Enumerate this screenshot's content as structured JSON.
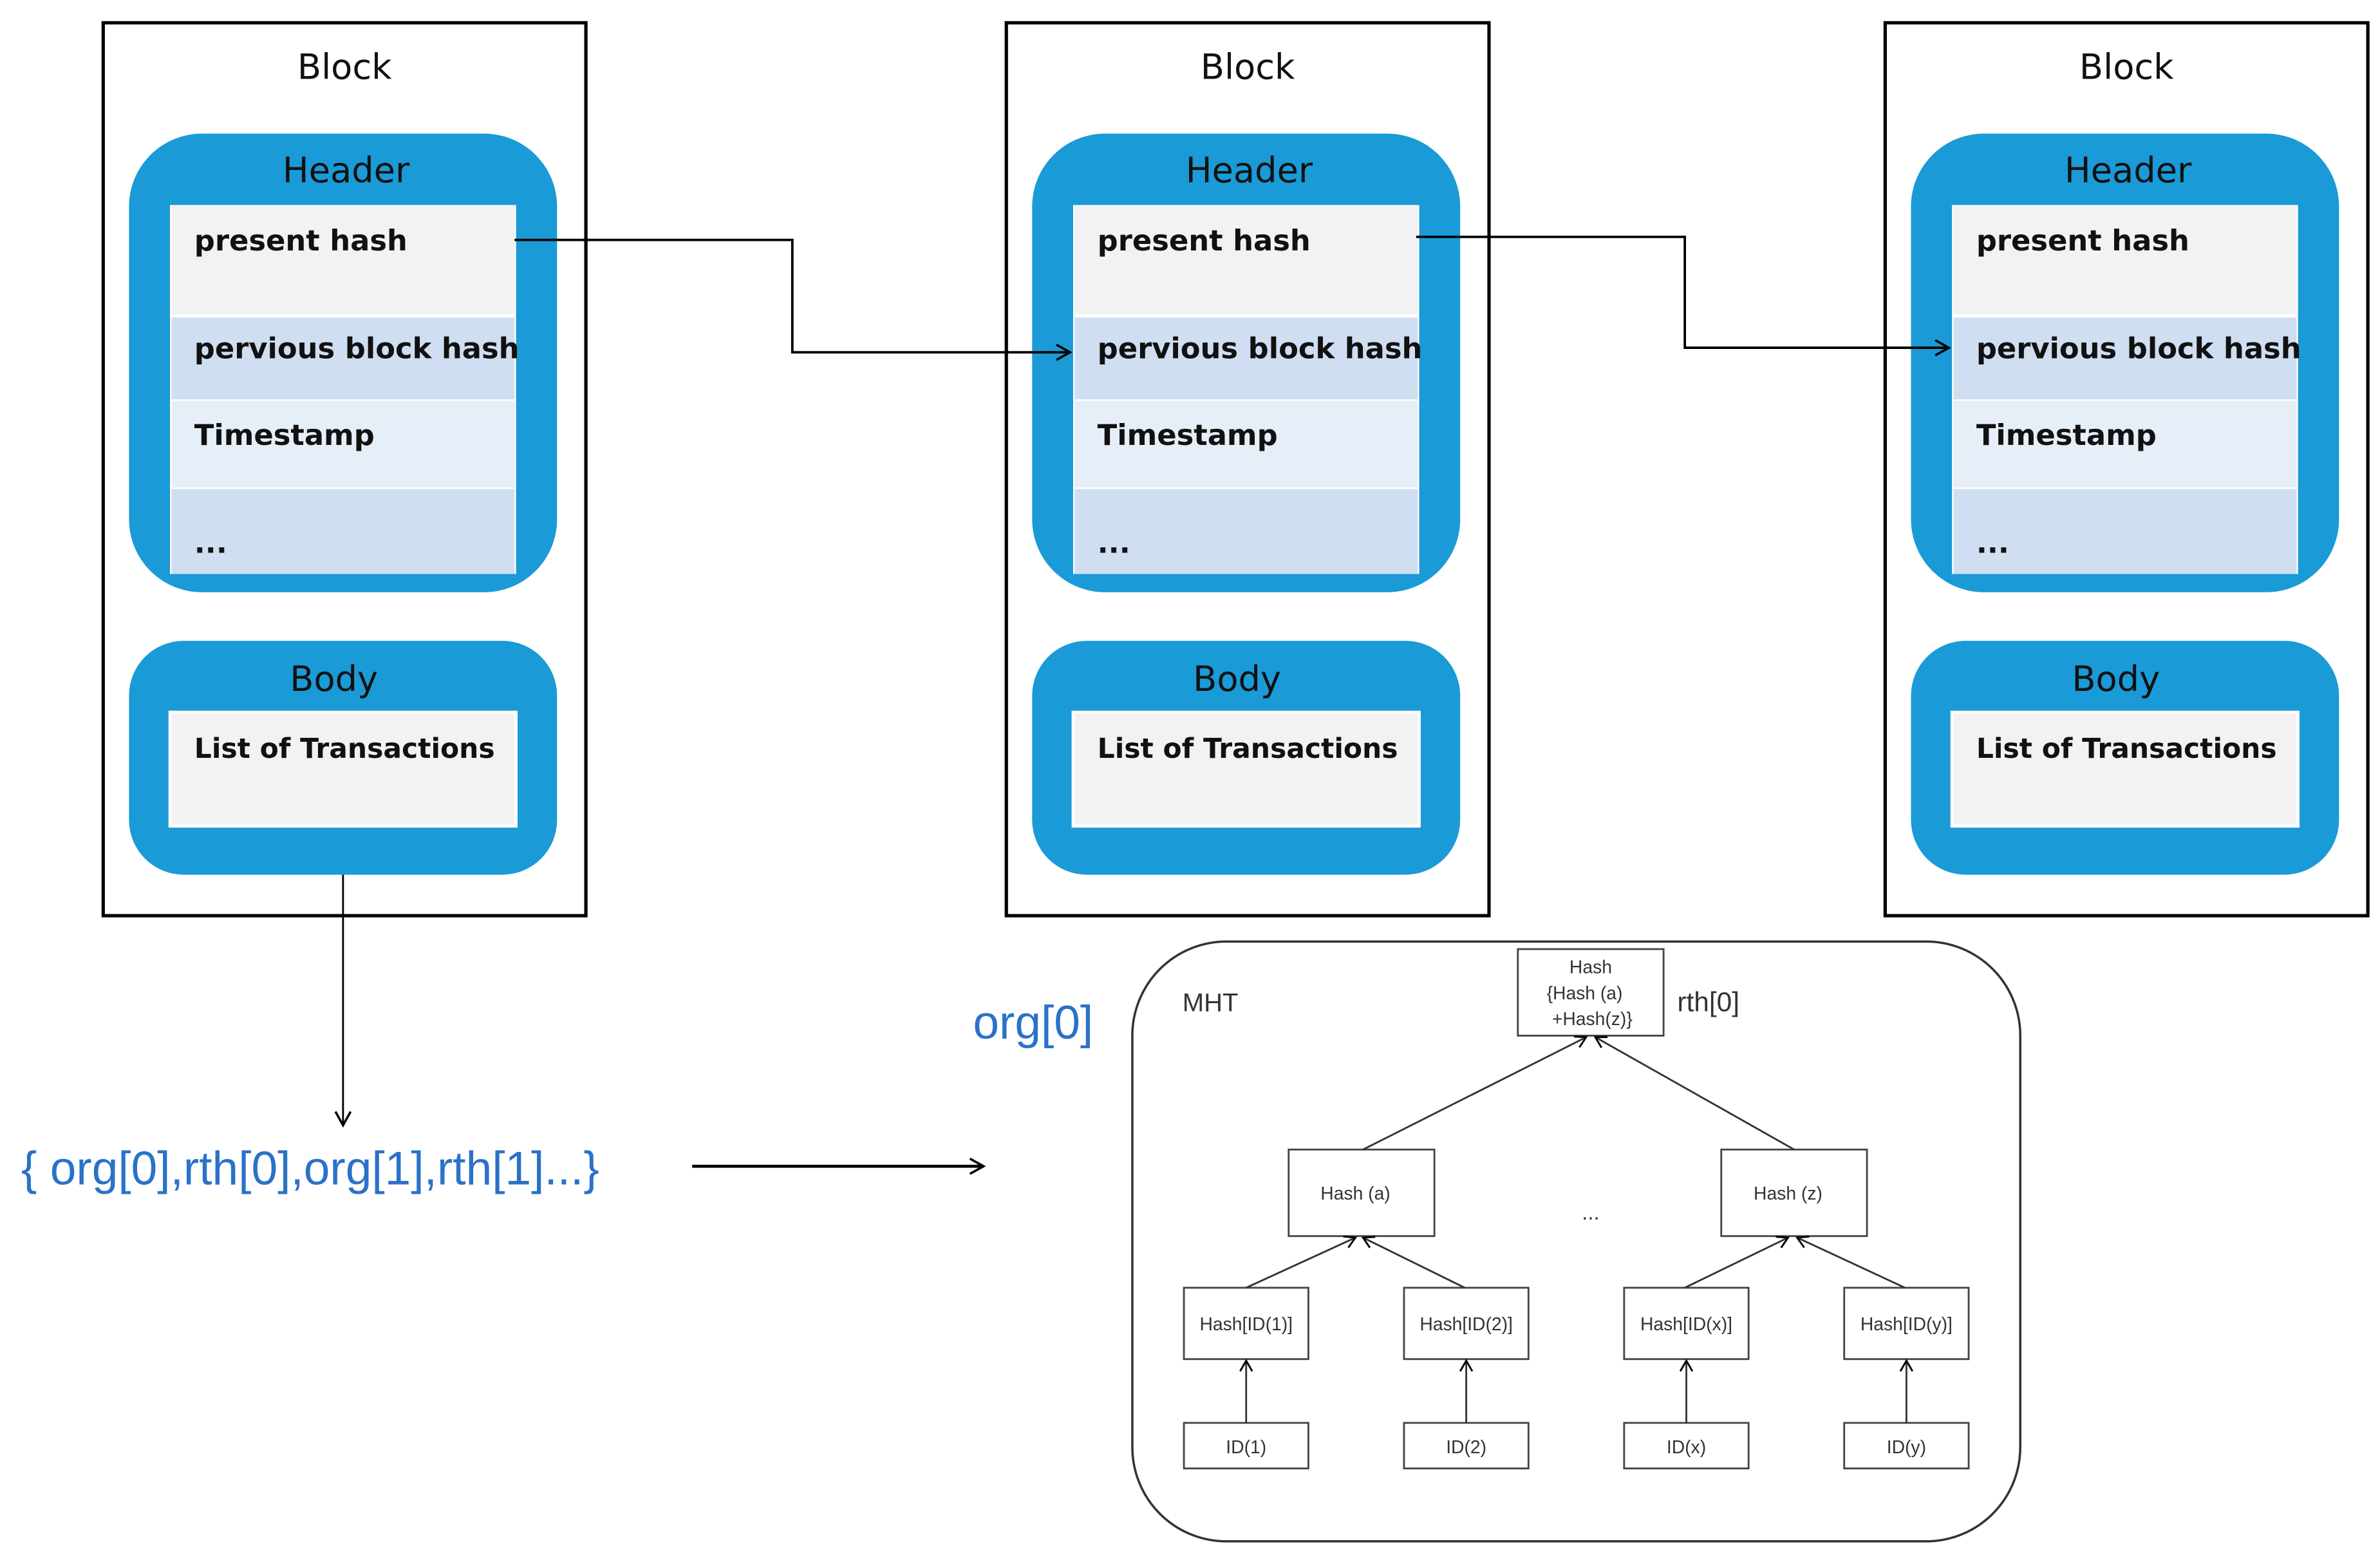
{
  "colors": {
    "accent": "#1a9ad6",
    "blue_text": "#2a72c8",
    "row_light": "#f2f2f2",
    "row_mid": "#cfdef0",
    "row_pale": "#e6eef8"
  },
  "blocks": [
    {
      "title": "Block",
      "header": {
        "title": "Header",
        "fields": [
          "present hash",
          "pervious block hash",
          "Timestamp",
          "..."
        ]
      },
      "body": {
        "title": "Body",
        "fields": [
          "List of Transactions"
        ]
      }
    },
    {
      "title": "Block",
      "header": {
        "title": "Header",
        "fields": [
          "present hash",
          "pervious block hash",
          "Timestamp",
          "..."
        ]
      },
      "body": {
        "title": "Body",
        "fields": [
          "List of Transactions"
        ]
      }
    },
    {
      "title": "Block",
      "header": {
        "title": "Header",
        "fields": [
          "present hash",
          "pervious block hash",
          "Timestamp",
          "..."
        ]
      },
      "body": {
        "title": "Body",
        "fields": [
          "List of Transactions"
        ]
      }
    }
  ],
  "transaction_set": "{ org[0],rth[0],org[1],rth[1]...}",
  "org_label": "org[0]",
  "mht": {
    "title": "MHT",
    "root": {
      "lines": [
        "Hash",
        "{Hash (a)",
        "+Hash(z)}"
      ],
      "label": "rth[0]"
    },
    "level1": [
      "Hash (a)",
      "Hash (z)"
    ],
    "ellipsis": "...",
    "level2": [
      "Hash[ID(1)]",
      "Hash[ID(2)]",
      "Hash[ID(x)]",
      "Hash[ID(y)]"
    ],
    "leaves": [
      "ID(1)",
      "ID(2)",
      "ID(x)",
      "ID(y)"
    ]
  }
}
